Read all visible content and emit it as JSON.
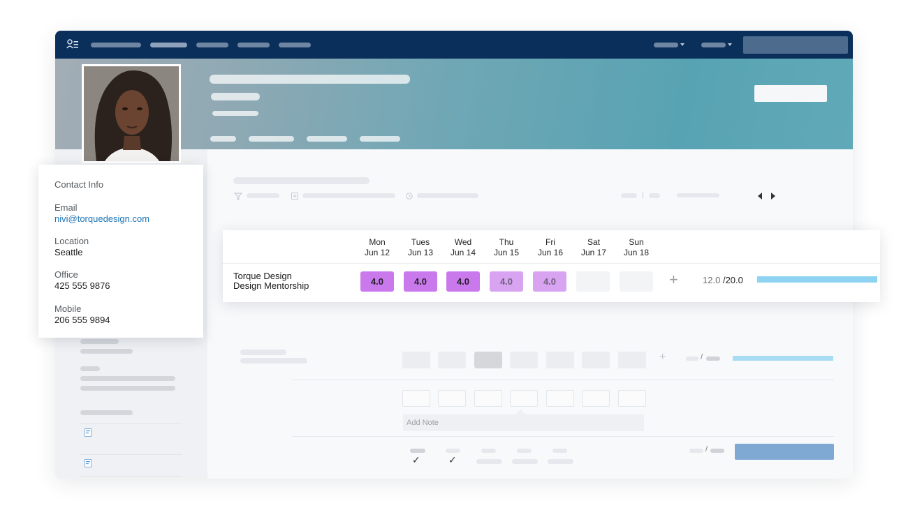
{
  "contact": {
    "heading": "Contact Info",
    "email_label": "Email",
    "email_value": "nivi@torquedesign.com",
    "location_label": "Location",
    "location_value": "Seattle",
    "office_label": "Office",
    "office_value": "425 555 9876",
    "mobile_label": "Mobile",
    "mobile_value": "206 555 9894"
  },
  "timesheet": {
    "days": [
      {
        "day": "Mon",
        "date": "Jun 12"
      },
      {
        "day": "Tues",
        "date": "Jun 13"
      },
      {
        "day": "Wed",
        "date": "Jun 14"
      },
      {
        "day": "Thu",
        "date": "Jun 15"
      },
      {
        "day": "Fri",
        "date": "Jun 16"
      },
      {
        "day": "Sat",
        "date": "Jun 17"
      },
      {
        "day": "Sun",
        "date": "Jun 18"
      }
    ],
    "project_client": "Torque Design",
    "project_name": "Design Mentorship",
    "hours": [
      "4.0",
      "4.0",
      "4.0",
      "4.0",
      "4.0",
      "",
      ""
    ],
    "add_symbol": "+",
    "logged": "12.0",
    "separator": "/",
    "target": "20.0",
    "progress_fraction": 0.6,
    "colors": {
      "cell_entered": "#c979ec",
      "cell_pending": "#d8a4f2",
      "progress": "#8fd3f2"
    }
  },
  "note": {
    "placeholder": "Add Note"
  },
  "background_row": {
    "add_symbol": "+",
    "separator": "/"
  },
  "footer": {
    "separator": "/",
    "check_symbol": "✓"
  },
  "icons": {
    "nav_logo": "people-list-icon",
    "prev": "chevron-left-icon",
    "next": "chevron-right-icon"
  }
}
